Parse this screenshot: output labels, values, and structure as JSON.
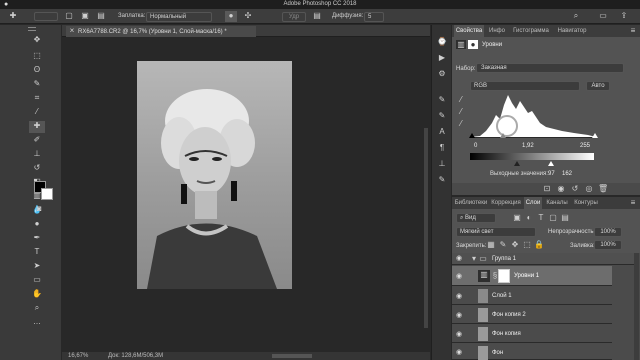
{
  "app_title": "Adobe Photoshop CC 2018",
  "options_bar": {
    "fill_label": "Заплатка:",
    "fill_mode": "Нормальный",
    "source_btn": "Удр",
    "diffusion_label": "Диффузия:",
    "diffusion_value": "5"
  },
  "document_tab": "RX6A7788.CR2 @ 16,7% (Уровни 1, Слой-маска/16) *",
  "status": {
    "zoom": "16,67%",
    "doc_info": "Док: 128,6M/506,3M"
  },
  "properties": {
    "tabs": [
      "Свойства",
      "Инфо",
      "Гистограмма",
      "Навигатор"
    ],
    "panel_title": "Уровни",
    "preset_label": "Набор:",
    "preset_value": "Заказная",
    "channel_value": "RGB",
    "auto_label": "Авто",
    "input_black": "0",
    "input_gamma": "1,92",
    "input_white": "255",
    "output_label": "Выходные значения:",
    "output_black": "97",
    "output_white": "162"
  },
  "layers_panel": {
    "tabs": [
      "Библиотеки",
      "Коррекция",
      "Слои",
      "Каналы",
      "Контуры"
    ],
    "kind_filter": "Вид",
    "blend_mode": "Мягкий свет",
    "opacity_label": "Непрозрачность:",
    "opacity_value": "100%",
    "lock_label": "Закрепить:",
    "fill_label": "Заливка:",
    "fill_value": "100%",
    "layers": [
      {
        "name": "Группа 1"
      },
      {
        "name": "Уровни 1"
      },
      {
        "name": "Слой 1"
      },
      {
        "name": "Фон копия 2"
      },
      {
        "name": "Фон копия"
      },
      {
        "name": "Фон"
      }
    ]
  },
  "icons": [
    "apple-icon",
    "move-tool-icon",
    "marquee-tool-icon",
    "lasso-tool-icon",
    "crop-tool-icon",
    "eyedropper-tool-icon",
    "healing-brush-icon",
    "brush-tool-icon",
    "clone-stamp-icon",
    "eraser-tool-icon",
    "gradient-tool-icon",
    "pen-tool-icon",
    "type-tool-icon",
    "path-selection-icon",
    "shape-tool-icon",
    "hand-tool-icon",
    "zoom-tool-icon",
    "eye-icon",
    "folder-icon",
    "link-icon"
  ],
  "colors": {
    "app_bg": "#282828",
    "panel_bg": "#535353",
    "canvas_bg": "#282828",
    "highlight": "#6d6d6d",
    "accent": "#3b6fb5"
  }
}
